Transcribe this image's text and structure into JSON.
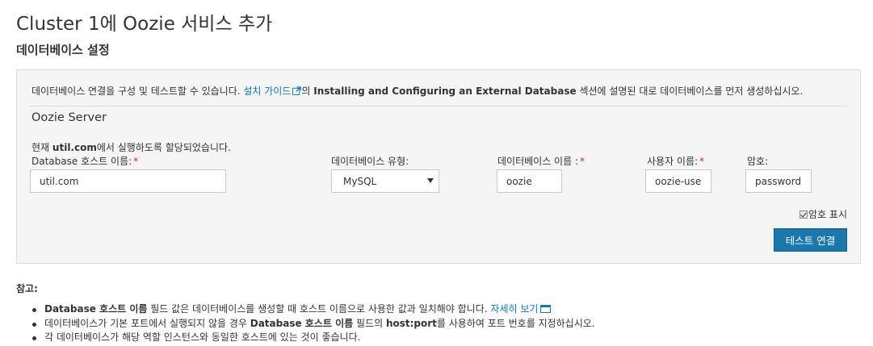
{
  "page": {
    "title": "Cluster 1에 Oozie 서비스 추가",
    "section_title": "데이터베이스 설정"
  },
  "intro": {
    "text_before": "데이터베이스 연결을 구성 및 테스트할 수 있습니다.",
    "guide_link": "설치 가이드",
    "text_mid": "의",
    "bold_section": "Installing and Configuring an External Database",
    "text_after": "섹션에 설명된 대로 데이터베이스를 먼저 생성하십시오."
  },
  "server": {
    "title": "Oozie Server",
    "host_note_before": "현재",
    "host_note_bold": "util.com",
    "host_note_after": "에서 실행하도록 할당되었습니다."
  },
  "fields": {
    "host_label": "Database 호스트 이름:",
    "host_value": "util.com",
    "type_label": "데이터베이스 유형:",
    "type_value": "MySQL",
    "name_label": "데이터베이스 이름 :",
    "name_value": "oozie",
    "user_label": "사용자 이름:",
    "user_value": "oozie-user",
    "password_label": "암호:",
    "password_value": "password",
    "required_mark": "*"
  },
  "show_password_label": "암호 표시",
  "test_button_label": "테스트 연결",
  "notes": {
    "title": "참고:",
    "item1_bold": "Database 호스트 이름",
    "item1_text": "필드 값은 데이터베이스를 생성할 때 호스트 이름으로 사용한 값과 일치해야 합니다.",
    "item1_link": "자세히 보기",
    "item2_text_before": "데이터베이스가 기본 포트에서 실행되지 않을 경우",
    "item2_bold1": "Database 호스트 이름",
    "item2_text_mid": "필드의",
    "item2_bold2": "host:port",
    "item2_text_after": "를 사용하여 포트 번호를 지정하십시오.",
    "item3_text": "각 데이터베이스가 해당 역할 인스턴스와 동일한 호스트에 있는 것이 좋습니다."
  },
  "colors": {
    "link": "#0a7bb6",
    "button": "#1a78ad",
    "required": "#c0282d"
  }
}
